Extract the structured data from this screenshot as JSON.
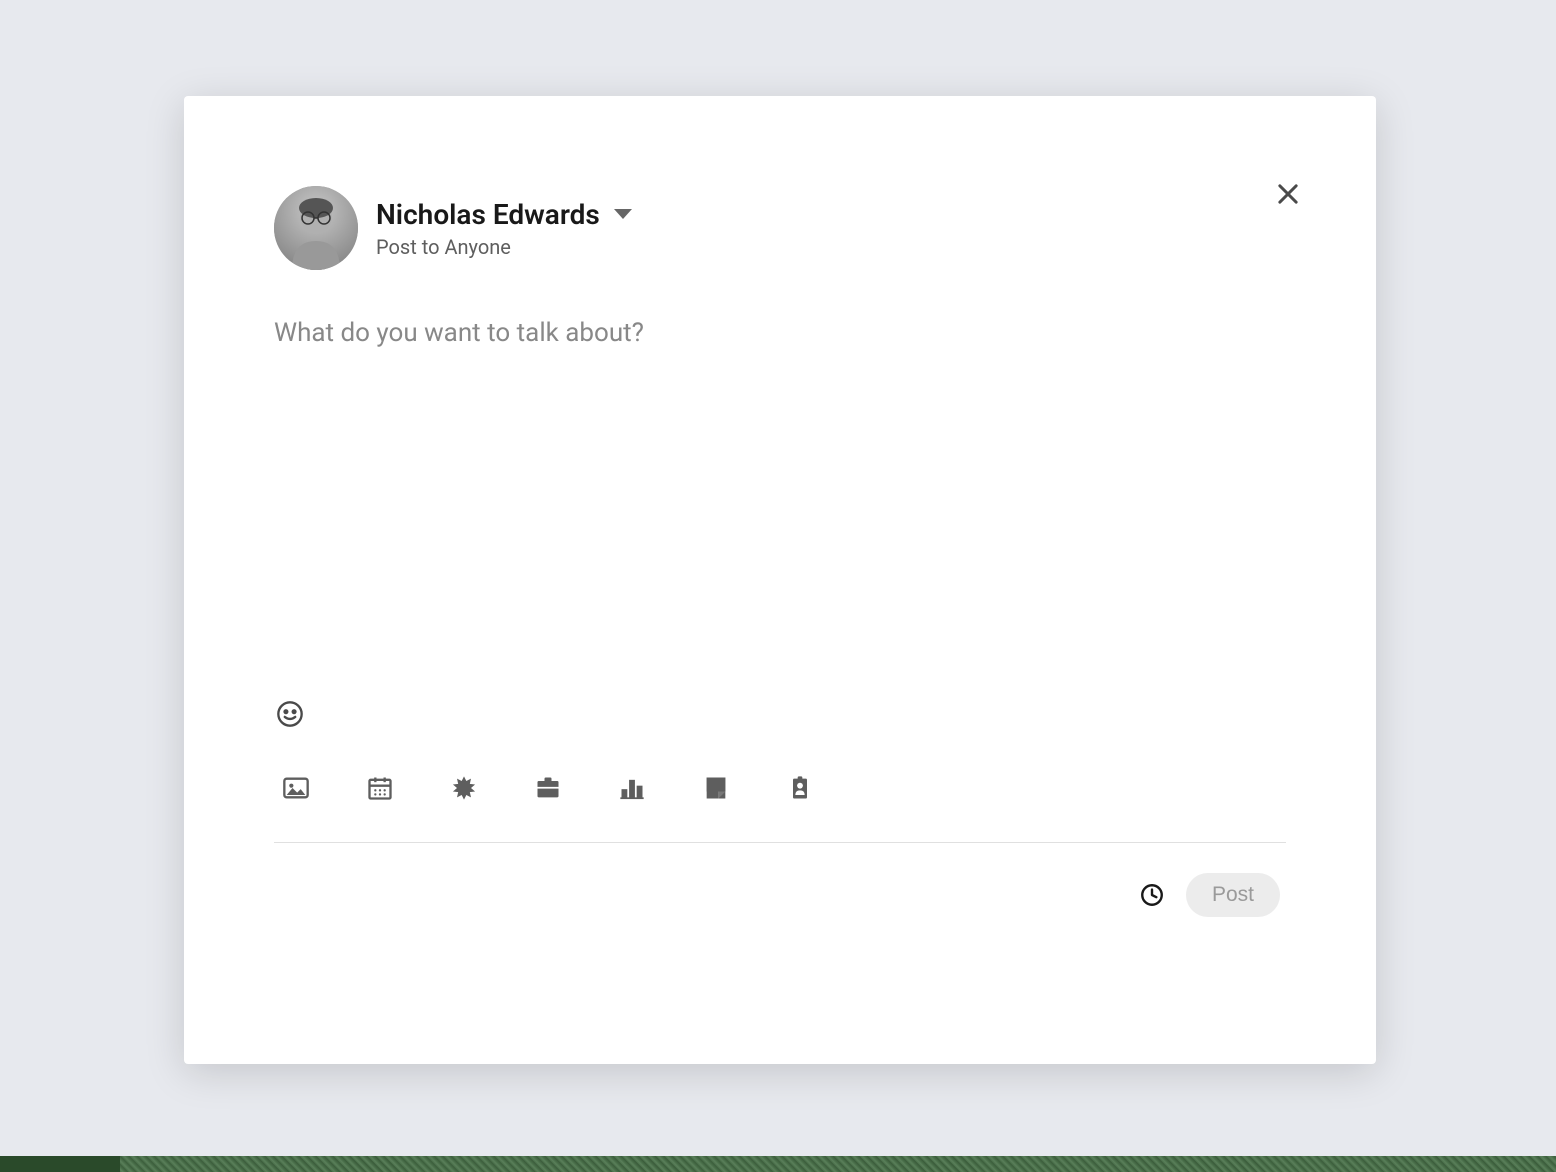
{
  "modal": {
    "user_name": "Nicholas Edwards",
    "visibility_label": "Post to Anyone",
    "composer_placeholder": "What do you want to talk about?",
    "post_button_label": "Post"
  },
  "icons": {
    "close": "close-icon",
    "dropdown": "chevron-down-icon",
    "emoji": "smiley-icon",
    "attachments": [
      "image-icon",
      "calendar-icon",
      "starburst-icon",
      "briefcase-icon",
      "bar-chart-icon",
      "document-icon",
      "person-badge-icon"
    ],
    "schedule": "clock-icon"
  }
}
